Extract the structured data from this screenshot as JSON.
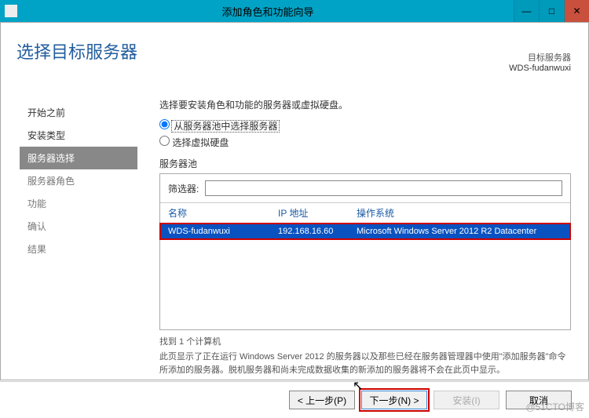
{
  "window": {
    "title": "添加角色和功能向导",
    "min": "—",
    "max": "□",
    "close": "✕"
  },
  "heading": "选择目标服务器",
  "destination": {
    "label": "目标服务器",
    "server": "WDS-fudanwuxi"
  },
  "sidebar": {
    "items": [
      {
        "label": "开始之前"
      },
      {
        "label": "安装类型"
      },
      {
        "label": "服务器选择"
      },
      {
        "label": "服务器角色"
      },
      {
        "label": "功能"
      },
      {
        "label": "确认"
      },
      {
        "label": "结果"
      }
    ]
  },
  "main": {
    "instruction": "选择要安装角色和功能的服务器或虚拟硬盘。",
    "radio1": "从服务器池中选择服务器",
    "radio2": "选择虚拟硬盘",
    "pool_label": "服务器池",
    "filter_label": "筛选器:",
    "filter_value": "",
    "columns": {
      "name": "名称",
      "ip": "IP 地址",
      "os": "操作系统"
    },
    "rows": [
      {
        "name": "WDS-fudanwuxi",
        "ip": "192.168.16.60",
        "os": "Microsoft Windows Server 2012 R2 Datacenter"
      }
    ],
    "found": "找到 1 个计算机",
    "explain": "此页显示了正在运行 Windows Server 2012 的服务器以及那些已经在服务器管理器中使用\"添加服务器\"命令所添加的服务器。脱机服务器和尚未完成数据收集的新添加的服务器将不会在此页中显示。"
  },
  "footer": {
    "prev": "< 上一步(P)",
    "next": "下一步(N) >",
    "install": "安装(I)",
    "cancel": "取消"
  },
  "watermark": "@51CTO博客"
}
